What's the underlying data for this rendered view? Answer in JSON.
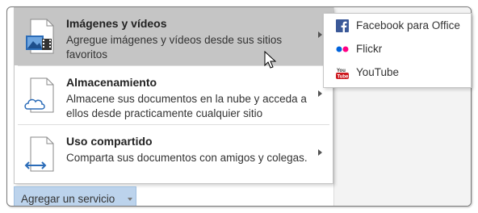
{
  "menu": {
    "items": [
      {
        "title": "Imágenes y vídeos",
        "description": "Agregue imágenes y vídeos desde sus sitios favoritos",
        "icon": "images-icon",
        "highlighted": true
      },
      {
        "title": "Almacenamiento",
        "description": "Almacene sus documentos en la nube y acceda a ellos desde practicamente cualquier sitio",
        "icon": "cloud-storage-icon",
        "highlighted": false
      },
      {
        "title": "Uso compartido",
        "description": "Comparta sus documentos con amigos y colegas.",
        "icon": "share-icon",
        "highlighted": false
      }
    ]
  },
  "submenu": {
    "items": [
      {
        "label": "Facebook para Office",
        "icon": "facebook-icon"
      },
      {
        "label": "Flickr",
        "icon": "flickr-icon"
      },
      {
        "label": "YouTube",
        "icon": "youtube-icon"
      }
    ]
  },
  "add_service": {
    "label": "Agregar un servicio"
  },
  "colors": {
    "highlight": "#c5c5c5",
    "button_bg": "#bcd3ec",
    "facebook": "#3b5998",
    "flickr_blue": "#0063dc",
    "flickr_pink": "#ff0084",
    "youtube": "#cc181e",
    "accent": "#2b6cb8"
  }
}
